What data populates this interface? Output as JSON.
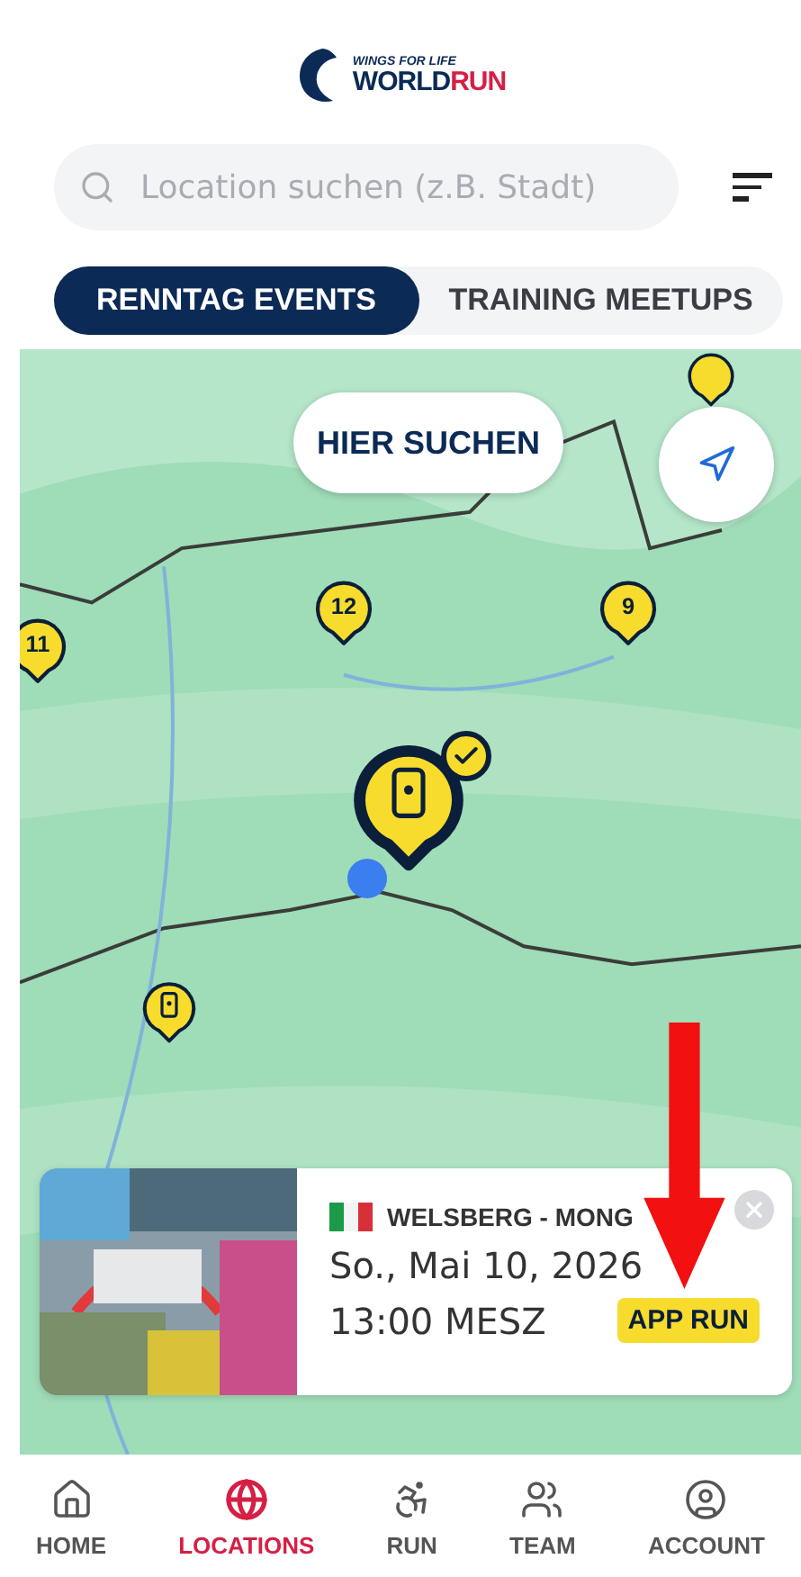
{
  "logo": {
    "top": "WINGS FOR LIFE",
    "world": "WORLD",
    "run": "RUN"
  },
  "search": {
    "placeholder": "Location suchen (z.B. Stadt)"
  },
  "tabs": [
    {
      "label": "RENNTAG EVENTS",
      "selected": true
    },
    {
      "label": "TRAINING MEETUPS",
      "selected": false
    }
  ],
  "map": {
    "kind": "picture",
    "search_here": "HIER SUCHEN",
    "markers": [
      {
        "kind": "cluster",
        "selected": false
      },
      {
        "kind": "cluster",
        "count": "12",
        "selected": false
      },
      {
        "kind": "cluster",
        "count": "9",
        "selected": false
      },
      {
        "kind": "cluster",
        "count": "11",
        "selected": false
      },
      {
        "kind": "event",
        "selected": true
      },
      {
        "kind": "event",
        "selected": false
      },
      {
        "kind": "user"
      }
    ]
  },
  "event_card": {
    "title": "WELSBERG - MONG",
    "date": "So., Mai 10, 2026",
    "time": "13:00 MESZ",
    "badge": "APP RUN"
  },
  "nav": [
    {
      "label": "HOME",
      "selected": false
    },
    {
      "label": "LOCATIONS",
      "selected": true
    },
    {
      "label": "RUN",
      "selected": false
    },
    {
      "label": "TEAM",
      "selected": false
    },
    {
      "label": "ACCOUNT",
      "selected": false
    }
  ]
}
